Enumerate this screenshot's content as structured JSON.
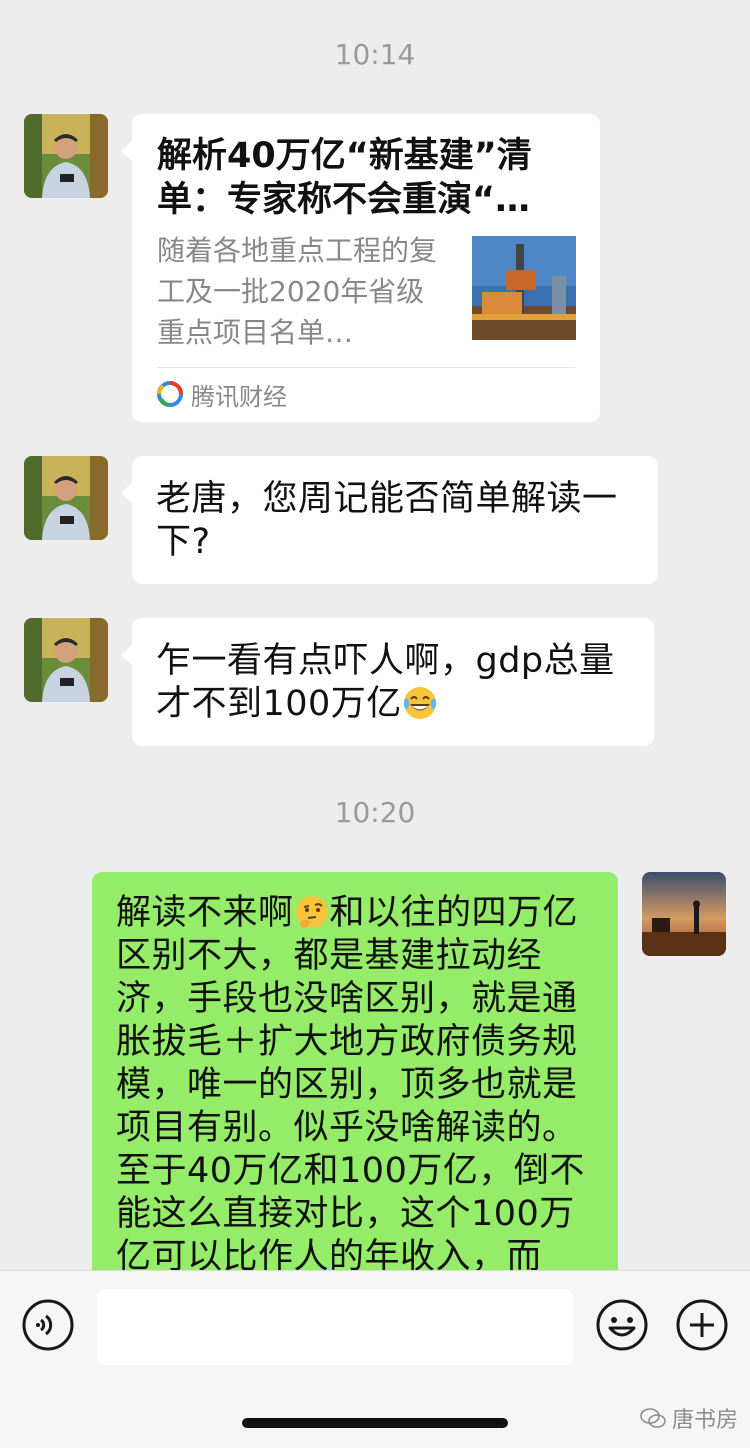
{
  "timestamps": [
    "10:14",
    "10:20"
  ],
  "messages": {
    "card": {
      "title": "解析40万亿“新基建”清单：专家称不会重演“…",
      "description": "随着各地重点工程的复工及一批2020年省级重点项目名单…",
      "source": "腾讯财经"
    },
    "msg2": "老唐，您周记能否简单解读一下?",
    "msg3": "乍一看有点吓人啊，gdp总量才不到100万亿",
    "msg4_part1": "解读不来啊",
    "msg4_part2": "和以往的四万亿区别不大，都是基建拉动经济，手段也没啥区别，就是通胀拔毛＋扩大地方政府债务规模，唯一的区别，顶多也就是项目有别。似乎没啥解读的。至于40万亿和100万亿，倒不能这么直接对比，这个100万亿可以比作人的年收入，而"
  },
  "composer": {
    "voice_icon": "voice-icon",
    "emoji_icon": "emoji-icon",
    "plus_icon": "plus-icon"
  },
  "watermark": {
    "label": "唐书房",
    "icon": "wechat-icon"
  },
  "colors": {
    "background": "#ededed",
    "self_bubble": "#95ec69",
    "other_bubble": "#ffffff",
    "timestamp": "#9a9a9a"
  }
}
